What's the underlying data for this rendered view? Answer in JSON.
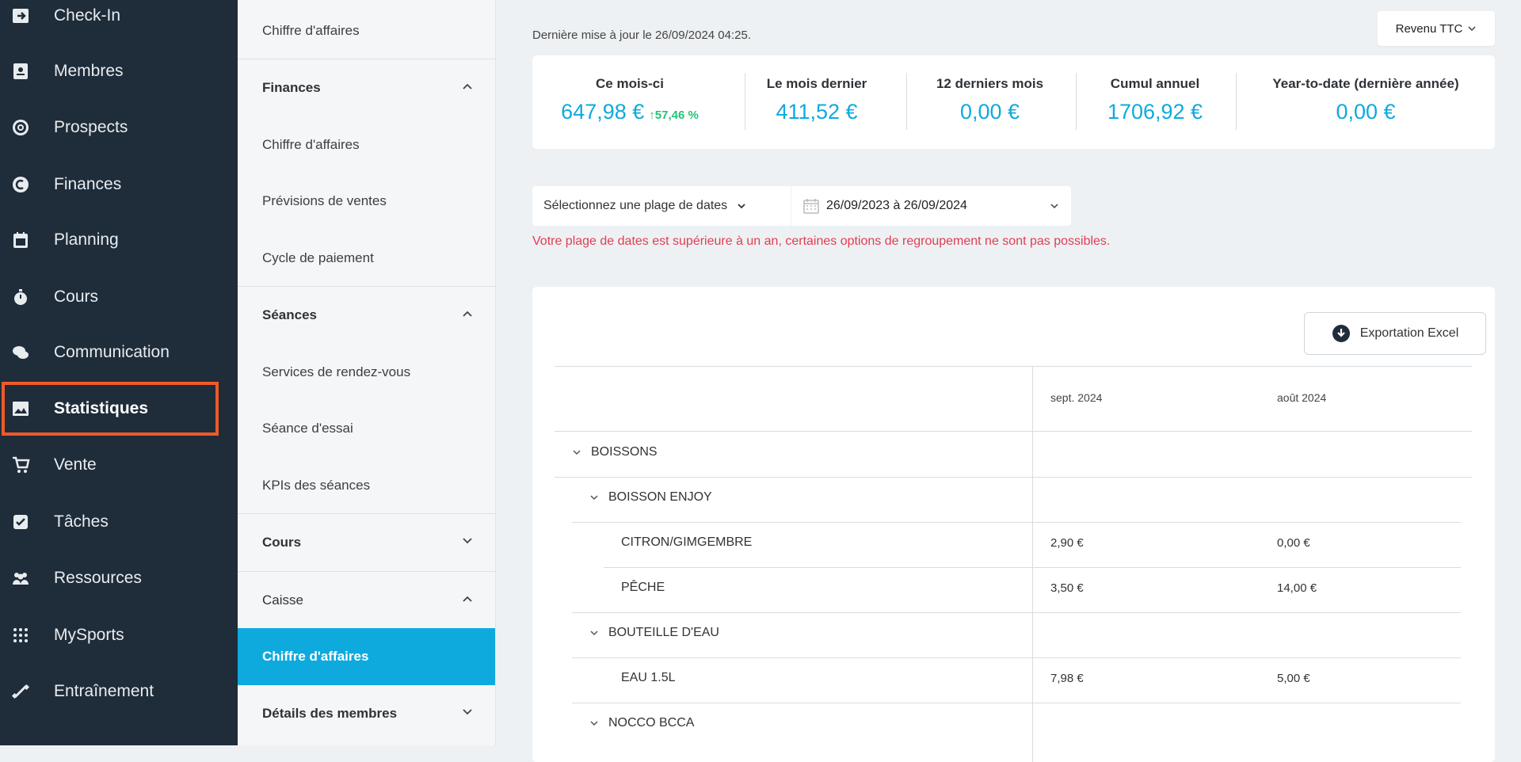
{
  "sidebar": {
    "items": [
      {
        "label": "Check-In",
        "icon": "check-in-icon"
      },
      {
        "label": "Membres",
        "icon": "members-card-icon"
      },
      {
        "label": "Prospects",
        "icon": "target-icon"
      },
      {
        "label": "Finances",
        "icon": "euro-coin-icon"
      },
      {
        "label": "Planning",
        "icon": "calendar-icon"
      },
      {
        "label": "Cours",
        "icon": "stopwatch-icon"
      },
      {
        "label": "Communication",
        "icon": "chat-bubbles-icon"
      },
      {
        "label": "Statistiques",
        "icon": "chart-image-icon",
        "active": true
      },
      {
        "label": "Vente",
        "icon": "shopping-cart-icon"
      },
      {
        "label": "Tâches",
        "icon": "checkbox-icon"
      },
      {
        "label": "Ressources",
        "icon": "people-group-icon"
      },
      {
        "label": "MySports",
        "icon": "mysports-logo-icon"
      },
      {
        "label": "Entraînement",
        "icon": "dumbbell-icon"
      }
    ],
    "highlight_color": "#f05a28"
  },
  "subnav": {
    "items": [
      {
        "label": "Chiffre d'affaires",
        "type": "item"
      },
      {
        "label": "Finances",
        "type": "header",
        "chevron": "up"
      },
      {
        "label": "Chiffre d'affaires",
        "type": "item"
      },
      {
        "label": "Prévisions de ventes",
        "type": "item"
      },
      {
        "label": "Cycle de paiement",
        "type": "item"
      },
      {
        "label": "Séances",
        "type": "header",
        "chevron": "up"
      },
      {
        "label": "Services de rendez-vous",
        "type": "item"
      },
      {
        "label": "Séance d'essai",
        "type": "item"
      },
      {
        "label": "KPIs des séances",
        "type": "item"
      },
      {
        "label": "Cours",
        "type": "header",
        "chevron": "down"
      },
      {
        "label": "Caisse",
        "type": "header",
        "chevron": "up"
      },
      {
        "label": "Chiffre d'affaires",
        "type": "item",
        "active": true
      },
      {
        "label": "Détails des membres",
        "type": "header",
        "chevron": "down"
      }
    ]
  },
  "main": {
    "update_text": "Dernière mise à jour le 26/09/2024 04:25.",
    "revenue_select": "Revenu TTC",
    "kpis": [
      {
        "label": "Ce mois-ci",
        "value": "647,98 €",
        "delta": "↑57,46 %"
      },
      {
        "label": "Le mois dernier",
        "value": "411,52 €"
      },
      {
        "label": "12 derniers mois",
        "value": "0,00 €"
      },
      {
        "label": "Cumul annuel",
        "value": "1706,92 €"
      },
      {
        "label": "Year-to-date (dernière année)",
        "value": "0,00 €"
      }
    ],
    "date_select_label": "Sélectionnez une plage de dates",
    "date_range_value": "26/09/2023 à 26/09/2024",
    "warning_text": "Votre plage de dates est supérieure à un an, certaines options de regroupement ne sont pas possibles.",
    "export_label": "Exportation Excel",
    "table": {
      "columns": [
        "sept. 2024",
        "août 2024"
      ],
      "rows": [
        {
          "label": "BOISSONS",
          "level": 0,
          "group": true,
          "values": [
            "",
            ""
          ]
        },
        {
          "label": "BOISSON ENJOY",
          "level": 1,
          "group": true,
          "values": [
            "",
            ""
          ]
        },
        {
          "label": "CITRON/GIMGEMBRE",
          "level": 2,
          "group": false,
          "values": [
            "2,90 €",
            "0,00 €"
          ]
        },
        {
          "label": "PÊCHE",
          "level": 2,
          "group": false,
          "values": [
            "3,50 €",
            "14,00 €"
          ]
        },
        {
          "label": "BOUTEILLE D'EAU",
          "level": 1,
          "group": true,
          "values": [
            "",
            ""
          ]
        },
        {
          "label": "EAU 1.5L",
          "level": 2,
          "group": false,
          "values": [
            "7,98 €",
            "5,00 €"
          ]
        },
        {
          "label": "NOCCO BCCA",
          "level": 1,
          "group": true,
          "values": [
            "",
            ""
          ]
        }
      ]
    }
  },
  "colors": {
    "accent": "#0eaade",
    "sidebar_bg": "#1f2c3a",
    "warning": "#e03e52",
    "positive": "#25c27a"
  }
}
